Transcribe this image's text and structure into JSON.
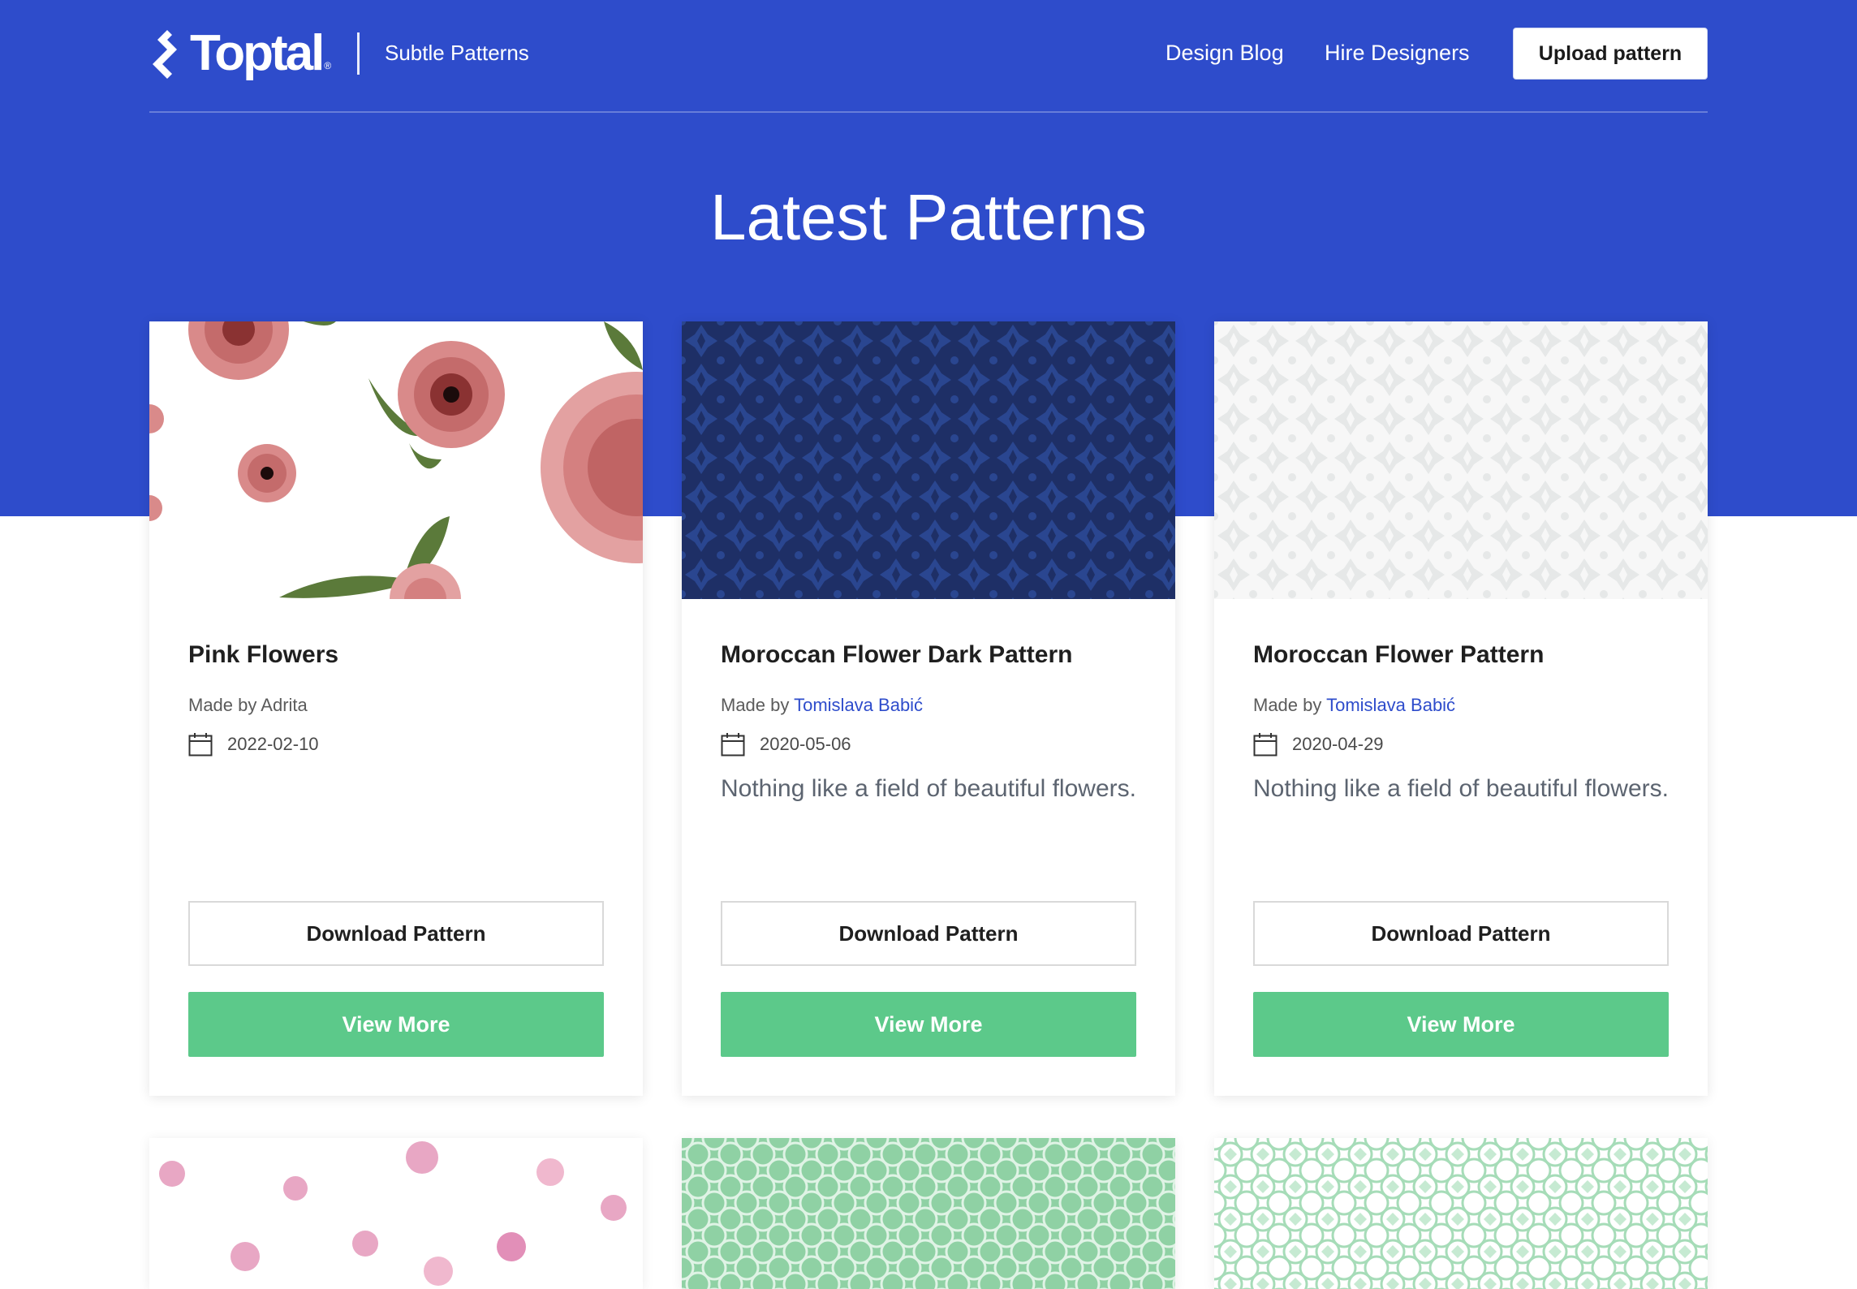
{
  "colors": {
    "brand_blue": "#2e4ccb",
    "accent_green": "#5cc98a",
    "link_blue": "#2e4ccb"
  },
  "header": {
    "logo_text": "Toptal",
    "logo_icon": "toptal-diamond-icon",
    "site_name": "Subtle Patterns",
    "nav": [
      {
        "label": "Design Blog"
      },
      {
        "label": "Hire Designers"
      }
    ],
    "upload_label": "Upload pattern"
  },
  "page": {
    "title": "Latest Patterns"
  },
  "cards": [
    {
      "title": "Pink Flowers",
      "made_by_prefix": "Made by ",
      "author": "Adrita",
      "date": "2022-02-10",
      "description": "",
      "download_label": "Download Pattern",
      "view_label": "View More"
    },
    {
      "title": "Moroccan Flower Dark Pattern",
      "made_by_prefix": "Made by ",
      "author": "Tomislava Babić",
      "date": "2020-05-06",
      "description": "Nothing like a field of beautiful flowers.",
      "download_label": "Download Pattern",
      "view_label": "View More"
    },
    {
      "title": "Moroccan Flower Pattern",
      "made_by_prefix": "Made by ",
      "author": "Tomislava Babić",
      "date": "2020-04-29",
      "description": "Nothing like a field of beautiful flowers.",
      "download_label": "Download Pattern",
      "view_label": "View More"
    }
  ]
}
